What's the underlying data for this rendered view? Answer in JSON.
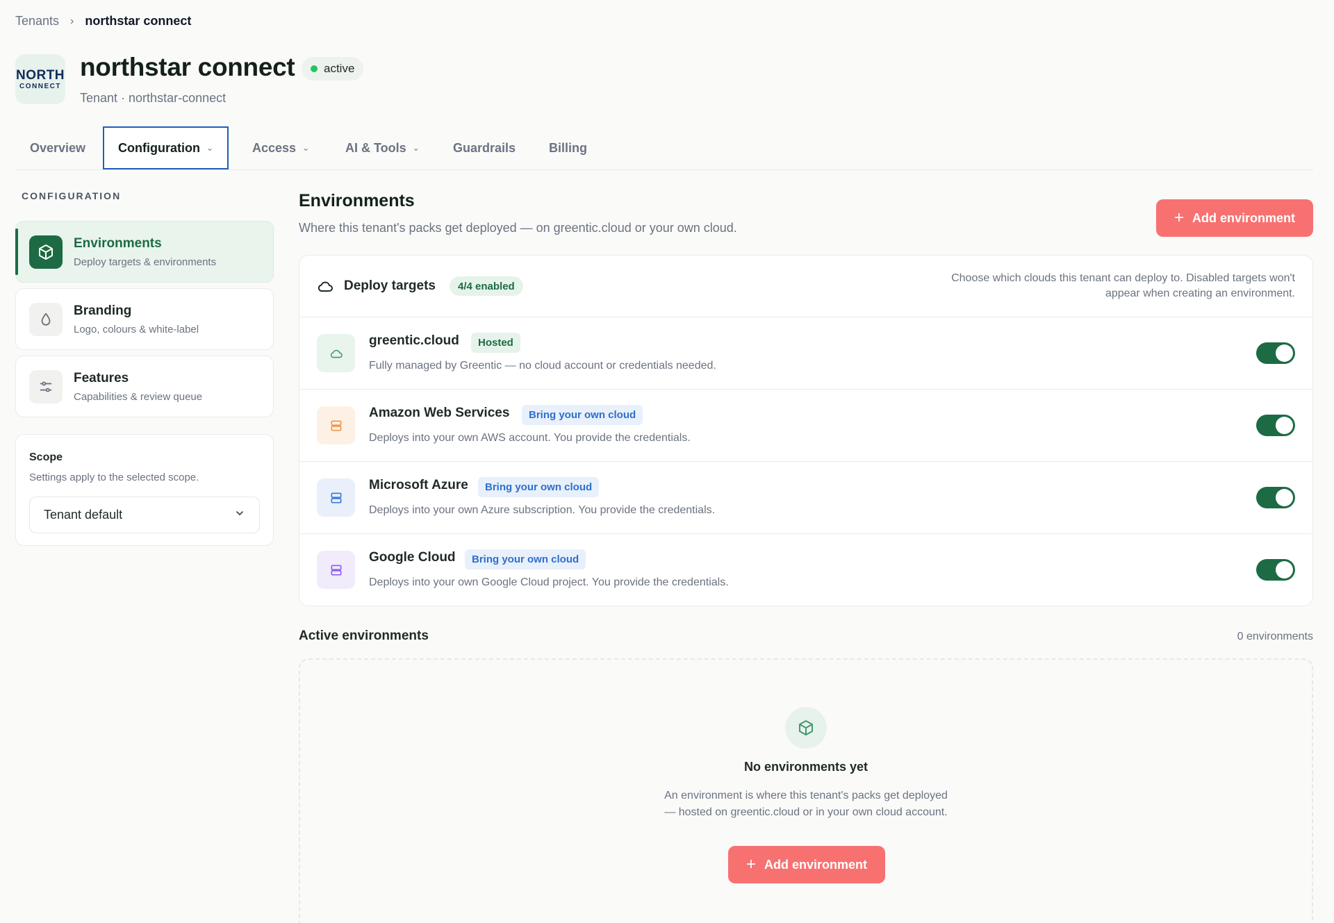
{
  "breadcrumb": {
    "parent": "Tenants",
    "separator": "›",
    "current": "northstar connect"
  },
  "header": {
    "logo_top": "NORTH",
    "logo_bottom": "CONNECT",
    "title": "northstar connect",
    "status": "active",
    "subtitle": "Tenant · northstar-connect"
  },
  "tabs": [
    {
      "label": "Overview"
    },
    {
      "label": "Configuration",
      "active": true
    },
    {
      "label": "Access"
    },
    {
      "label": "AI & Tools"
    },
    {
      "label": "Guardrails"
    },
    {
      "label": "Billing"
    }
  ],
  "sidebar": {
    "section_label": "CONFIGURATION",
    "items": [
      {
        "title": "Environments",
        "subtitle": "Deploy targets & environments",
        "icon": "cube-icon",
        "active": true
      },
      {
        "title": "Branding",
        "subtitle": "Logo, colours & white-label",
        "icon": "droplet-icon"
      },
      {
        "title": "Features",
        "subtitle": "Capabilities & review queue",
        "icon": "sliders-icon"
      }
    ],
    "scope": {
      "title": "Scope",
      "subtitle": "Settings apply to the selected scope.",
      "selected": "Tenant default"
    }
  },
  "main": {
    "title": "Environments",
    "subtitle": "Where this tenant's packs get deployed — on greentic.cloud or your own cloud.",
    "add_button": "Add environment",
    "deploy_targets": {
      "title": "Deploy targets",
      "enabled_badge": "4/4 enabled",
      "note": "Choose which clouds this tenant can deploy to. Disabled targets won't appear when creating an environment.",
      "rows": [
        {
          "name": "greentic.cloud",
          "badge": "Hosted",
          "description": "Fully managed by Greentic — no cloud account or credentials needed.",
          "enabled": true
        },
        {
          "name": "Amazon Web Services",
          "badge": "Bring your own cloud",
          "description": "Deploys into your own AWS account. You provide the credentials.",
          "enabled": true
        },
        {
          "name": "Microsoft Azure",
          "badge": "Bring your own cloud",
          "description": "Deploys into your own Azure subscription. You provide the credentials.",
          "enabled": true
        },
        {
          "name": "Google Cloud",
          "badge": "Bring your own cloud",
          "description": "Deploys into your own Google Cloud project. You provide the credentials.",
          "enabled": true
        }
      ]
    },
    "active_environments": {
      "title": "Active environments",
      "count": "0 environments",
      "empty_title": "No environments yet",
      "empty_description": "An environment is where this tenant's packs get deployed — hosted on greentic.cloud or in your own cloud account.",
      "add_button": "Add environment"
    }
  },
  "colors": {
    "brand_green": "#1c6b44",
    "accent_coral": "#f87171",
    "active_tab_border": "#1e5fb8",
    "status_dot": "#22c55e"
  }
}
